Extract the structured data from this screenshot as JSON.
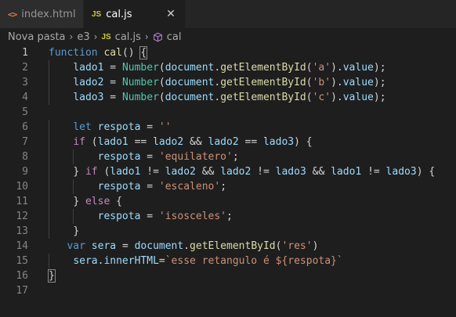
{
  "tabs": [
    {
      "icon": "<>",
      "label": "index.html",
      "active": false
    },
    {
      "icon": "JS",
      "label": "cal.js",
      "active": true,
      "close": "✕"
    }
  ],
  "breadcrumb": {
    "items": [
      "Nova pasta",
      "e3",
      "cal.js",
      "cal"
    ],
    "separator": "›",
    "js_icon": "JS"
  },
  "editor": {
    "language": "javascript",
    "line_numbers": [
      "1",
      "2",
      "3",
      "4",
      "5",
      "6",
      "7",
      "8",
      "9",
      "10",
      "11",
      "12",
      "13",
      "14",
      "15",
      "16",
      "17"
    ],
    "current_line": 1,
    "lines": [
      "function cal() {",
      "    lado1 = Number(document.getElementById('a').value);",
      "    lado2 = Number(document.getElementById('b').value);",
      "    lado3 = Number(document.getElementById('c').value);",
      "",
      "    let respota = ''",
      "    if (lado1 == lado2 && lado2 == lado3) {",
      "        respota = 'equilatero';",
      "    } if (lado1 != lado2 && lado2 != lado3 && lado1 != lado3) {",
      "        respota = 'escaleno';",
      "    } else {",
      "        respota = 'isosceles';",
      "    }",
      "   var sera = document.getElementById('res')",
      "    sera.innerHTML=`esse retangulo é ${respota}`",
      "}",
      ""
    ]
  },
  "colors": {
    "background": "#1e1e1e",
    "keyword": "#569cd6",
    "control": "#c586c0",
    "function": "#dcdcaa",
    "variable": "#9cdcfe",
    "class": "#4ec9b0",
    "string": "#ce9178"
  }
}
